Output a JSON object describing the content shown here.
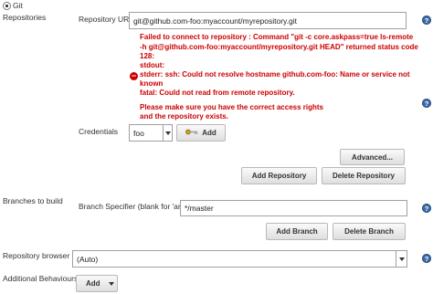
{
  "scm": {
    "git_label": "Git",
    "repositories_label": "Repositories"
  },
  "repository": {
    "url_label": "Repository URL",
    "url_value": "git@github.com-foo:myaccount/myrepository.git",
    "error_lines": [
      "Failed to connect to repository : Command \"git -c core.askpass=true ls-remote",
      "-h git@github.com-foo:myaccount/myrepository.git HEAD\" returned status code",
      "128:",
      "stdout:",
      "stderr: ssh: Could not resolve hostname github.com-foo: Name or service not",
      "known",
      "fatal: Could not read from remote repository.",
      "",
      "Please make sure you have the correct access rights",
      "and the repository exists."
    ],
    "credentials_label": "Credentials",
    "credentials_value": "foo",
    "add_credentials_label": "Add",
    "advanced_label": "Advanced...",
    "add_repository_label": "Add Repository",
    "delete_repository_label": "Delete Repository"
  },
  "branches": {
    "section_label": "Branches to build",
    "specifier_label": "Branch Specifier (blank for 'any')",
    "specifier_value": "*/master",
    "add_branch_label": "Add Branch",
    "delete_branch_label": "Delete Branch"
  },
  "browser": {
    "label": "Repository browser",
    "value": "(Auto)"
  },
  "behaviours": {
    "label": "Additional Behaviours",
    "add_label": "Add"
  },
  "help_glyph": "?",
  "error_glyph": "−",
  "colors": {
    "error": "#cc0000",
    "help": "#3b6aa8"
  }
}
